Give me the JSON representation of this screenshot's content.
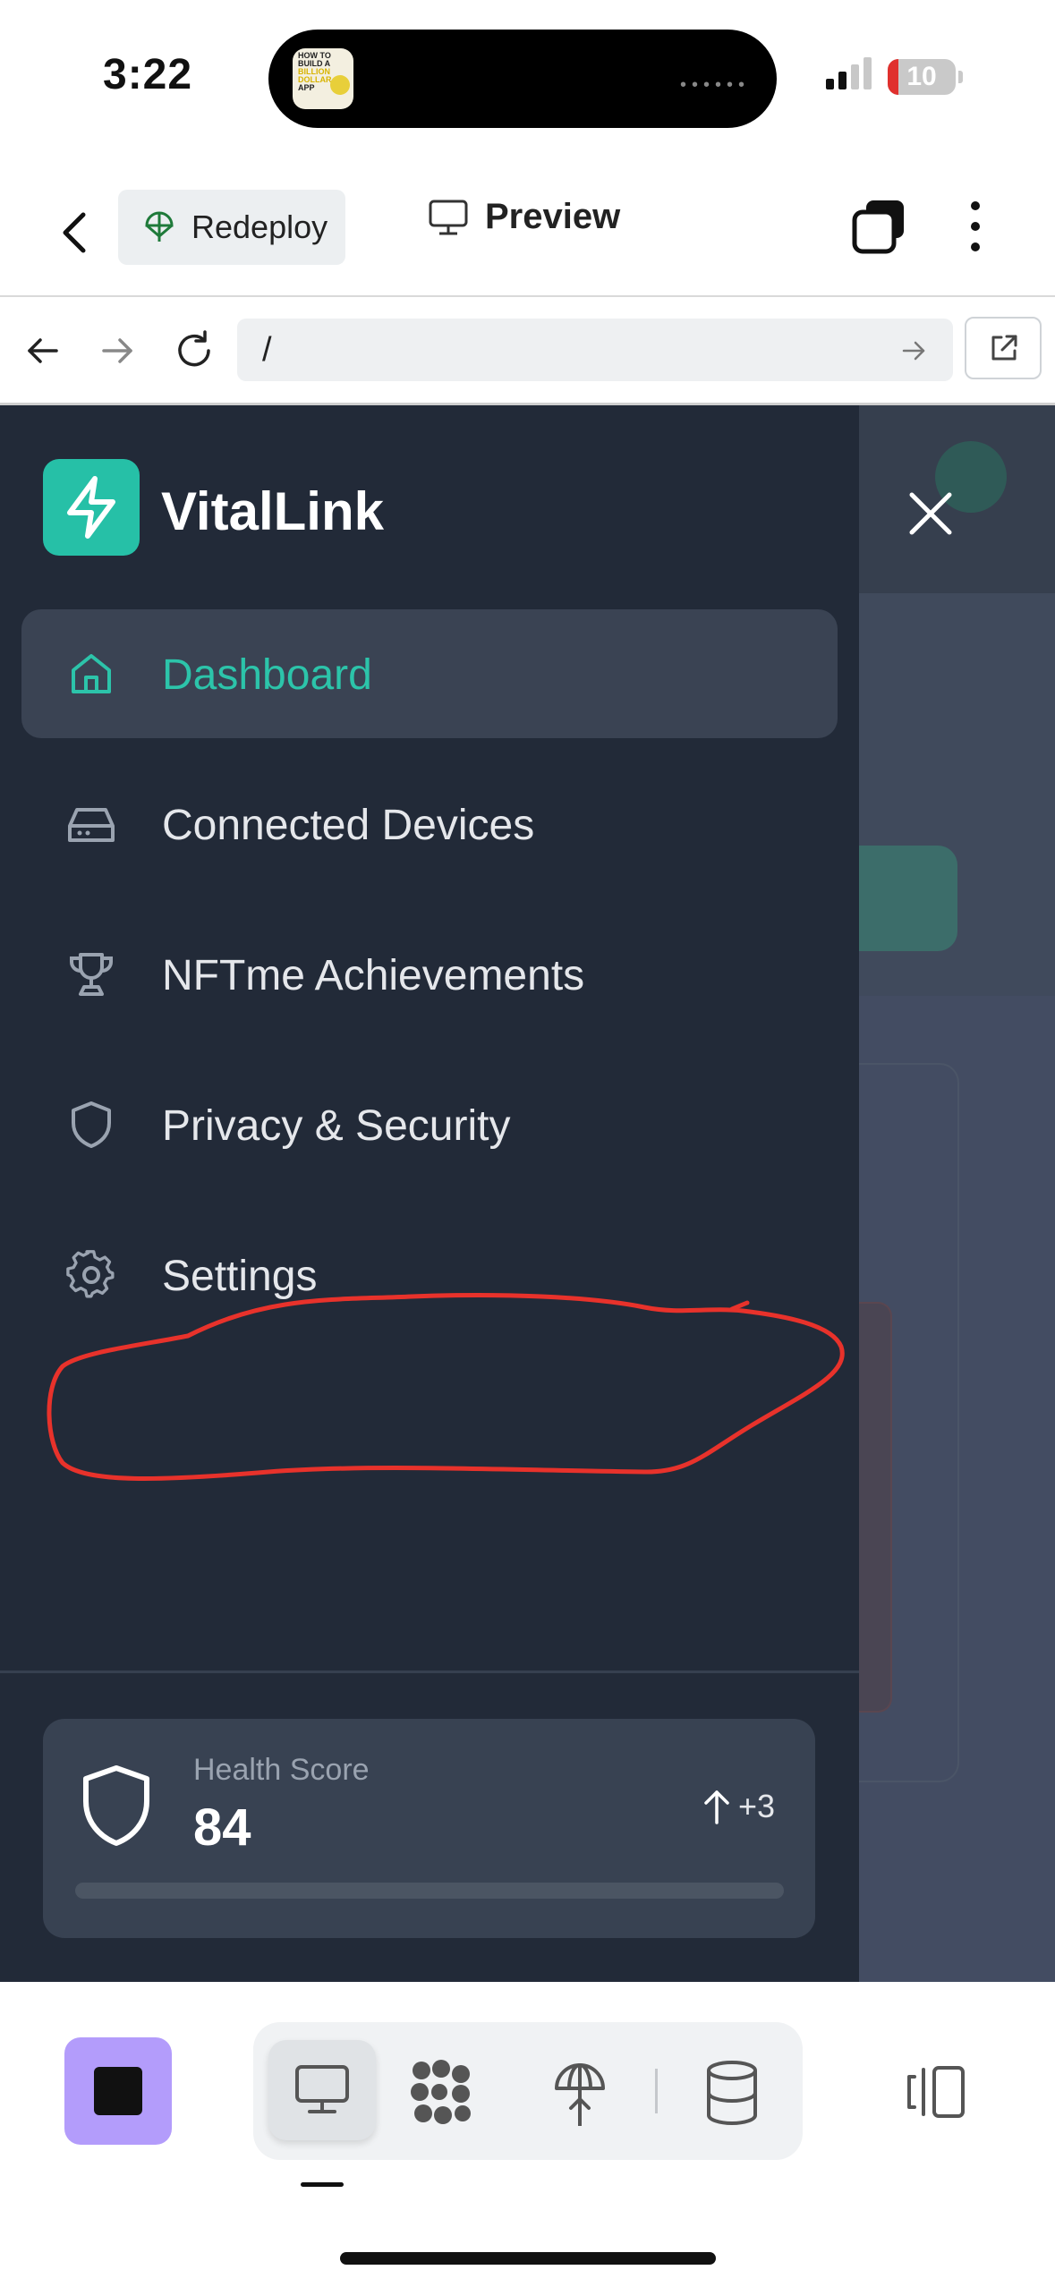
{
  "status_bar": {
    "time": "3:22",
    "battery_level": "10"
  },
  "island": {
    "thumbnail_lines": [
      "HOW TO",
      "BUILD A",
      "BILLION",
      "DOLLAR",
      "APP"
    ]
  },
  "app_bar": {
    "redeploy_label": "Redeploy",
    "preview_label": "Preview"
  },
  "browser": {
    "url": "/"
  },
  "sidebar": {
    "brand": "VitalLink",
    "items": [
      {
        "label": "Dashboard",
        "icon": "home-icon",
        "active": true
      },
      {
        "label": "Connected Devices",
        "icon": "hard-drive-icon",
        "active": false
      },
      {
        "label": "NFTme Achievements",
        "icon": "trophy-icon",
        "active": false
      },
      {
        "label": "Privacy & Security",
        "icon": "shield-icon",
        "active": false
      },
      {
        "label": "Settings",
        "icon": "gear-icon",
        "active": false
      }
    ]
  },
  "health": {
    "label": "Health Score",
    "value": "84",
    "delta": "+3",
    "progress": 0
  },
  "colors": {
    "accent": "#2cc4aa",
    "sidebar_bg": "#222a38",
    "annotation": "#e8322b",
    "stop_button": "#b39cfb"
  }
}
